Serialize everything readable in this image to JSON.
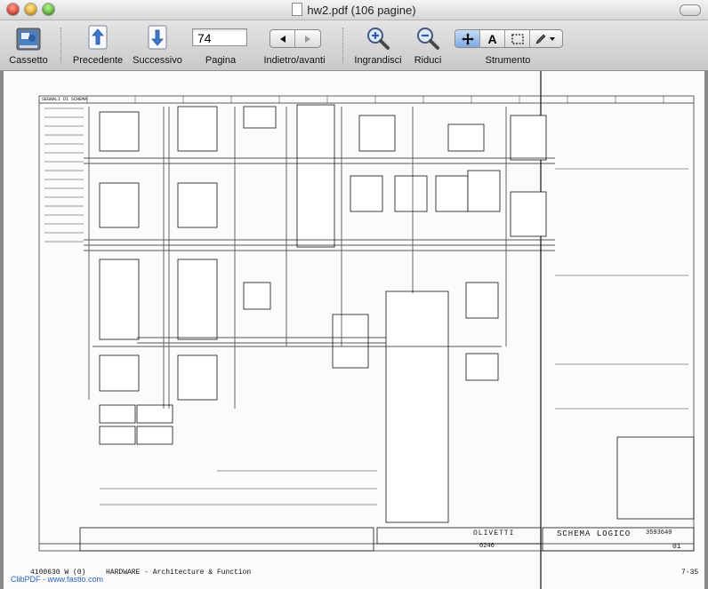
{
  "window": {
    "title": "hw2.pdf (106 pagine)"
  },
  "toolbar": {
    "drawer_label": "Cassetto",
    "prev_label": "Precedente",
    "next_label": "Successivo",
    "page_label": "Pagina",
    "page_value": "74",
    "backfwd_label": "Indietro/avanti",
    "zoom_in_label": "Ingrandisci",
    "zoom_out_label": "Riduci",
    "tool_label": "Strumento",
    "tool_text_glyph": "A"
  },
  "document": {
    "footer_left": "4100630 W (0)",
    "footer_center": "HARDWARE - Architecture & Function",
    "footer_right": "7-35",
    "watermark": "ClibPDF - www.fastio.com",
    "company": "OLIVETTI",
    "schema_title": "SCHEMA LOGICO",
    "sheet_code": "0246",
    "drawing_number": "3593640",
    "sheet_number": "01",
    "top_left_label": "SEGNALI DI SCHEMA"
  },
  "colors": {
    "accent": "#5b8fd8",
    "watermark": "#2a63c6"
  }
}
